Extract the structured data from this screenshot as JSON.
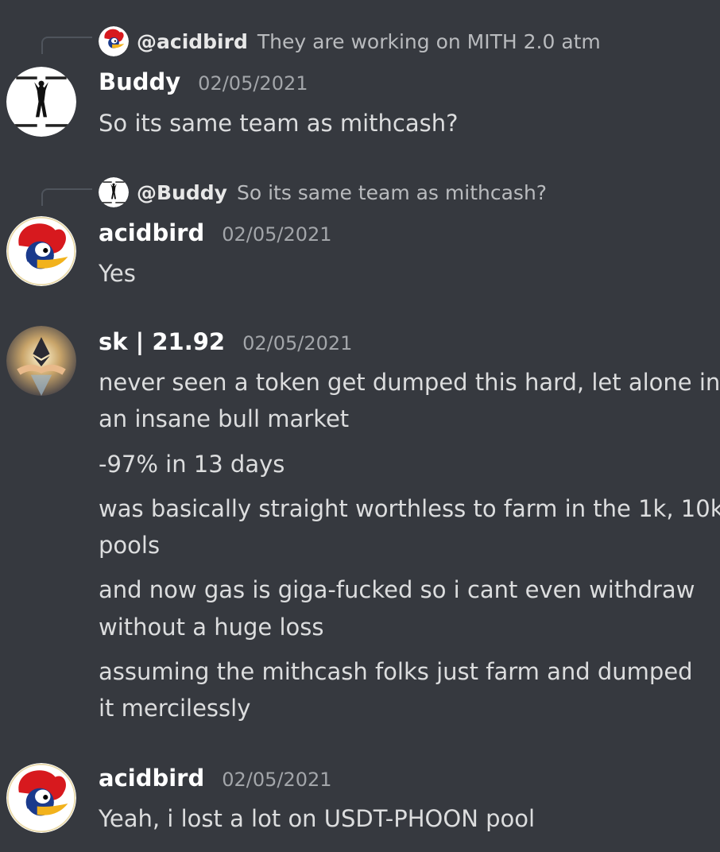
{
  "colors": {
    "background": "#36393f",
    "text": "#dcddde",
    "muted": "#a3a6aa",
    "reply_line": "#4f545c"
  },
  "messages": [
    {
      "reply": {
        "name": "@acidbird",
        "text": "They are working on MITH 2.0 atm",
        "avatar": "woody-woodpecker-icon"
      },
      "username": "Buddy",
      "timestamp": "02/05/2021",
      "avatar": "buddy-avatar",
      "lines": [
        "So its same team as mithcash?"
      ]
    },
    {
      "reply": {
        "name": "@Buddy",
        "text": "So its same team as mithcash?",
        "avatar": "buddy-avatar"
      },
      "username": "acidbird",
      "timestamp": "02/05/2021",
      "avatar": "woody-woodpecker-icon",
      "lines": [
        "Yes"
      ]
    },
    {
      "username": "sk | 21.92",
      "timestamp": "02/05/2021",
      "avatar": "ethereum-avatar",
      "lines": [
        "never seen a token get dumped this hard, let alone in",
        "an insane bull market",
        "-97% in 13 days",
        "was basically straight worthless to farm in the 1k, 10k",
        "pools",
        "and now gas is giga-fucked so i cant even withdraw",
        "without a huge loss",
        "assuming the mithcash folks just farm and  dumped",
        "it mercilessly"
      ]
    },
    {
      "username": "acidbird",
      "timestamp": "02/05/2021",
      "avatar": "woody-woodpecker-icon",
      "lines": [
        "Yeah, i lost a lot on USDT-PHOON pool"
      ]
    }
  ]
}
